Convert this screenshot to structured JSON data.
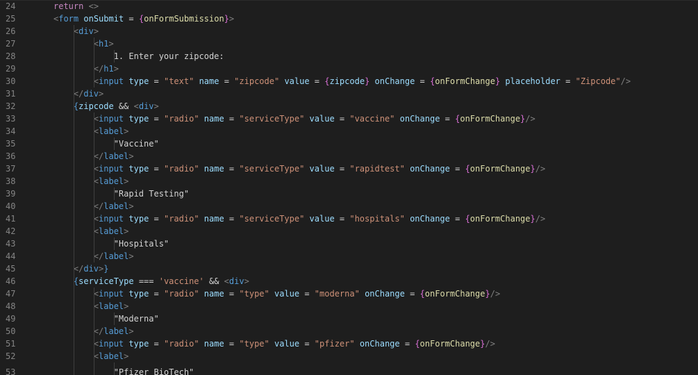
{
  "editor": {
    "lines": [
      {
        "num": "24",
        "indent": 1,
        "tokens": [
          [
            "kw",
            "return"
          ],
          [
            "pl",
            " "
          ],
          [
            "br",
            "<>"
          ]
        ]
      },
      {
        "num": "25",
        "indent": 1,
        "tokens": [
          [
            "br",
            "<"
          ],
          [
            "tag",
            "form"
          ],
          [
            "pl",
            " "
          ],
          [
            "attr",
            "onSubmit"
          ],
          [
            "op",
            " = "
          ],
          [
            "cb",
            "{"
          ],
          [
            "fn",
            "onFormSubmission"
          ],
          [
            "cb",
            "}"
          ],
          [
            "br",
            ">"
          ]
        ]
      },
      {
        "num": "26",
        "indent": 2,
        "tokens": [
          [
            "br",
            "<"
          ],
          [
            "tag",
            "div"
          ],
          [
            "br",
            ">"
          ]
        ]
      },
      {
        "num": "27",
        "indent": 3,
        "tokens": [
          [
            "br",
            "<"
          ],
          [
            "tag",
            "h1"
          ],
          [
            "br",
            ">"
          ]
        ]
      },
      {
        "num": "28",
        "indent": 4,
        "tokens": [
          [
            "pl",
            "1. Enter your zipcode:"
          ]
        ]
      },
      {
        "num": "29",
        "indent": 3,
        "tokens": [
          [
            "br",
            "</"
          ],
          [
            "tag",
            "h1"
          ],
          [
            "br",
            ">"
          ]
        ]
      },
      {
        "num": "30",
        "indent": 3,
        "tokens": [
          [
            "br",
            "<"
          ],
          [
            "tag",
            "input"
          ],
          [
            "pl",
            " "
          ],
          [
            "attr",
            "type"
          ],
          [
            "op",
            " = "
          ],
          [
            "str",
            "\"text\""
          ],
          [
            "pl",
            " "
          ],
          [
            "attr",
            "name"
          ],
          [
            "op",
            " = "
          ],
          [
            "str",
            "\"zipcode\""
          ],
          [
            "pl",
            " "
          ],
          [
            "attr",
            "value"
          ],
          [
            "op",
            " = "
          ],
          [
            "cb",
            "{"
          ],
          [
            "var",
            "zipcode"
          ],
          [
            "cb",
            "}"
          ],
          [
            "pl",
            " "
          ],
          [
            "attr",
            "onChange"
          ],
          [
            "op",
            " = "
          ],
          [
            "cb",
            "{"
          ],
          [
            "fn",
            "onFormChange"
          ],
          [
            "cb",
            "}"
          ],
          [
            "pl",
            " "
          ],
          [
            "attr",
            "placeholder"
          ],
          [
            "op",
            " = "
          ],
          [
            "str",
            "\"Zipcode\""
          ],
          [
            "br",
            "/>"
          ]
        ]
      },
      {
        "num": "31",
        "indent": 2,
        "tokens": [
          [
            "br",
            "</"
          ],
          [
            "tag",
            "div"
          ],
          [
            "br",
            ">"
          ]
        ]
      },
      {
        "num": "32",
        "indent": 2,
        "tokens": [
          [
            "tag",
            "{"
          ],
          [
            "var",
            "zipcode"
          ],
          [
            "op",
            " && "
          ],
          [
            "br",
            "<"
          ],
          [
            "tag",
            "div"
          ],
          [
            "br",
            ">"
          ]
        ]
      },
      {
        "num": "33",
        "indent": 3,
        "tokens": [
          [
            "br",
            "<"
          ],
          [
            "tag",
            "input"
          ],
          [
            "pl",
            " "
          ],
          [
            "attr",
            "type"
          ],
          [
            "op",
            " = "
          ],
          [
            "str",
            "\"radio\""
          ],
          [
            "pl",
            " "
          ],
          [
            "attr",
            "name"
          ],
          [
            "op",
            " = "
          ],
          [
            "str",
            "\"serviceType\""
          ],
          [
            "pl",
            " "
          ],
          [
            "attr",
            "value"
          ],
          [
            "op",
            " = "
          ],
          [
            "str",
            "\"vaccine\""
          ],
          [
            "pl",
            " "
          ],
          [
            "attr",
            "onChange"
          ],
          [
            "op",
            " = "
          ],
          [
            "cb",
            "{"
          ],
          [
            "fn",
            "onFormChange"
          ],
          [
            "cb",
            "}"
          ],
          [
            "br",
            "/>"
          ]
        ]
      },
      {
        "num": "34",
        "indent": 3,
        "tokens": [
          [
            "br",
            "<"
          ],
          [
            "tag",
            "label"
          ],
          [
            "br",
            ">"
          ]
        ]
      },
      {
        "num": "35",
        "indent": 4,
        "tokens": [
          [
            "pl",
            "\"Vaccine\""
          ]
        ]
      },
      {
        "num": "36",
        "indent": 3,
        "tokens": [
          [
            "br",
            "</"
          ],
          [
            "tag",
            "label"
          ],
          [
            "br",
            ">"
          ]
        ]
      },
      {
        "num": "37",
        "indent": 3,
        "tokens": [
          [
            "br",
            "<"
          ],
          [
            "tag",
            "input"
          ],
          [
            "pl",
            " "
          ],
          [
            "attr",
            "type"
          ],
          [
            "op",
            " = "
          ],
          [
            "str",
            "\"radio\""
          ],
          [
            "pl",
            " "
          ],
          [
            "attr",
            "name"
          ],
          [
            "op",
            " = "
          ],
          [
            "str",
            "\"serviceType\""
          ],
          [
            "pl",
            " "
          ],
          [
            "attr",
            "value"
          ],
          [
            "op",
            " = "
          ],
          [
            "str",
            "\"rapidtest\""
          ],
          [
            "pl",
            " "
          ],
          [
            "attr",
            "onChange"
          ],
          [
            "op",
            " = "
          ],
          [
            "cb",
            "{"
          ],
          [
            "fn",
            "onFormChange"
          ],
          [
            "cb",
            "}"
          ],
          [
            "br",
            "/>"
          ]
        ]
      },
      {
        "num": "38",
        "indent": 3,
        "tokens": [
          [
            "br",
            "<"
          ],
          [
            "tag",
            "label"
          ],
          [
            "br",
            ">"
          ]
        ]
      },
      {
        "num": "39",
        "indent": 4,
        "tokens": [
          [
            "pl",
            "\"Rapid Testing\""
          ]
        ]
      },
      {
        "num": "40",
        "indent": 3,
        "tokens": [
          [
            "br",
            "</"
          ],
          [
            "tag",
            "label"
          ],
          [
            "br",
            ">"
          ]
        ]
      },
      {
        "num": "41",
        "indent": 3,
        "tokens": [
          [
            "br",
            "<"
          ],
          [
            "tag",
            "input"
          ],
          [
            "pl",
            " "
          ],
          [
            "attr",
            "type"
          ],
          [
            "op",
            " = "
          ],
          [
            "str",
            "\"radio\""
          ],
          [
            "pl",
            " "
          ],
          [
            "attr",
            "name"
          ],
          [
            "op",
            " = "
          ],
          [
            "str",
            "\"serviceType\""
          ],
          [
            "pl",
            " "
          ],
          [
            "attr",
            "value"
          ],
          [
            "op",
            " = "
          ],
          [
            "str",
            "\"hospitals\""
          ],
          [
            "pl",
            " "
          ],
          [
            "attr",
            "onChange"
          ],
          [
            "op",
            " = "
          ],
          [
            "cb",
            "{"
          ],
          [
            "fn",
            "onFormChange"
          ],
          [
            "cb",
            "}"
          ],
          [
            "br",
            "/>"
          ]
        ]
      },
      {
        "num": "42",
        "indent": 3,
        "tokens": [
          [
            "br",
            "<"
          ],
          [
            "tag",
            "label"
          ],
          [
            "br",
            ">"
          ]
        ]
      },
      {
        "num": "43",
        "indent": 4,
        "tokens": [
          [
            "pl",
            "\"Hospitals\""
          ]
        ]
      },
      {
        "num": "44",
        "indent": 3,
        "tokens": [
          [
            "br",
            "</"
          ],
          [
            "tag",
            "label"
          ],
          [
            "br",
            ">"
          ]
        ]
      },
      {
        "num": "45",
        "indent": 2,
        "tokens": [
          [
            "br",
            "</"
          ],
          [
            "tag",
            "div"
          ],
          [
            "br",
            ">"
          ],
          [
            "tag",
            "}"
          ]
        ]
      },
      {
        "num": "46",
        "indent": 2,
        "tokens": [
          [
            "tag",
            "{"
          ],
          [
            "var",
            "serviceType"
          ],
          [
            "op",
            " === "
          ],
          [
            "str",
            "'vaccine'"
          ],
          [
            "op",
            " && "
          ],
          [
            "br",
            "<"
          ],
          [
            "tag",
            "div"
          ],
          [
            "br",
            ">"
          ]
        ]
      },
      {
        "num": "47",
        "indent": 3,
        "tokens": [
          [
            "br",
            "<"
          ],
          [
            "tag",
            "input"
          ],
          [
            "pl",
            " "
          ],
          [
            "attr",
            "type"
          ],
          [
            "op",
            " = "
          ],
          [
            "str",
            "\"radio\""
          ],
          [
            "pl",
            " "
          ],
          [
            "attr",
            "name"
          ],
          [
            "op",
            " = "
          ],
          [
            "str",
            "\"type\""
          ],
          [
            "pl",
            " "
          ],
          [
            "attr",
            "value"
          ],
          [
            "op",
            " = "
          ],
          [
            "str",
            "\"moderna\""
          ],
          [
            "pl",
            " "
          ],
          [
            "attr",
            "onChange"
          ],
          [
            "op",
            " = "
          ],
          [
            "cb",
            "{"
          ],
          [
            "fn",
            "onFormChange"
          ],
          [
            "cb",
            "}"
          ],
          [
            "br",
            "/>"
          ]
        ]
      },
      {
        "num": "48",
        "indent": 3,
        "tokens": [
          [
            "br",
            "<"
          ],
          [
            "tag",
            "label"
          ],
          [
            "br",
            ">"
          ]
        ]
      },
      {
        "num": "49",
        "indent": 4,
        "tokens": [
          [
            "pl",
            "\"Moderna\""
          ]
        ]
      },
      {
        "num": "50",
        "indent": 3,
        "tokens": [
          [
            "br",
            "</"
          ],
          [
            "tag",
            "label"
          ],
          [
            "br",
            ">"
          ]
        ]
      },
      {
        "num": "51",
        "indent": 3,
        "tokens": [
          [
            "br",
            "<"
          ],
          [
            "tag",
            "input"
          ],
          [
            "pl",
            " "
          ],
          [
            "attr",
            "type"
          ],
          [
            "op",
            " = "
          ],
          [
            "str",
            "\"radio\""
          ],
          [
            "pl",
            " "
          ],
          [
            "attr",
            "name"
          ],
          [
            "op",
            " = "
          ],
          [
            "str",
            "\"type\""
          ],
          [
            "pl",
            " "
          ],
          [
            "attr",
            "value"
          ],
          [
            "op",
            " = "
          ],
          [
            "str",
            "\"pfizer\""
          ],
          [
            "pl",
            " "
          ],
          [
            "attr",
            "onChange"
          ],
          [
            "op",
            " = "
          ],
          [
            "cb",
            "{"
          ],
          [
            "fn",
            "onFormChange"
          ],
          [
            "cb",
            "}"
          ],
          [
            "br",
            "/>"
          ]
        ]
      },
      {
        "num": "52",
        "indent": 3,
        "tokens": [
          [
            "br",
            "<"
          ],
          [
            "tag",
            "label"
          ],
          [
            "br",
            ">"
          ]
        ]
      },
      {
        "num": "53",
        "indent": 4,
        "tokens": [
          [
            "pl",
            "\"Pfizer BioTech\""
          ]
        ],
        "partial": true
      }
    ]
  }
}
